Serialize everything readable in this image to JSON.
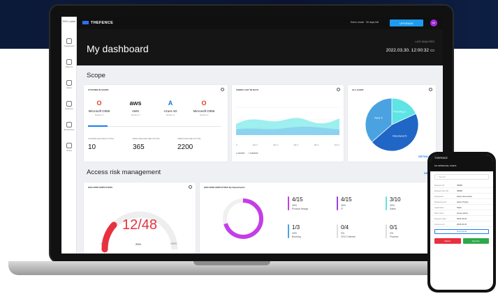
{
  "brand": "THEFENCE",
  "topbar": {
    "demo_mode": "Demo mode · 30 days left",
    "upgrade_label": "UPGRADE",
    "avatar_initials": "DP"
  },
  "sidebar": {
    "logo": "25% Label",
    "items": [
      {
        "label": "Dashboard",
        "icon": "home-icon"
      },
      {
        "label": "Reports",
        "icon": "document-icon"
      },
      {
        "label": "Alerts",
        "icon": "bell-icon"
      },
      {
        "label": "Systems",
        "icon": "layers-icon"
      },
      {
        "label": "Employees",
        "icon": "users-icon"
      },
      {
        "label": "Setup",
        "icon": "eye-icon"
      }
    ]
  },
  "header": {
    "title": "My dashboard",
    "last_analyzed_label": "LAST ANALYZED",
    "last_analyzed": "2022.03.30. 12:00:32"
  },
  "scope": {
    "title": "Scope",
    "systems_title": "SYSTEMS IN SCOPE",
    "systems": [
      {
        "logo": "O",
        "name": "Microsoft O365",
        "sub": "System 2",
        "color": "#e23b1e"
      },
      {
        "logo": "aws",
        "name": "AWS",
        "sub": "System 2",
        "color": "#222222"
      },
      {
        "logo": "A",
        "name": "Azure AD",
        "sub": "System 2",
        "color": "#1a73d9"
      },
      {
        "logo": "O",
        "name": "Microsoft O365",
        "sub": "System 2",
        "color": "#e23b1e"
      }
    ],
    "stats": [
      {
        "label": "SYSTEMS ANALYZED IN TOTAL",
        "value": "10"
      },
      {
        "label": "EMPLOYEE ANALYZED IN TOTAL",
        "value": "365"
      },
      {
        "label": "USERS ANALYZED IN TOTAL",
        "value": "2200"
      }
    ],
    "users_title": "USERS LAST 60 DAYS",
    "users_legend": [
      "Active",
      "Inactive"
    ],
    "users_x": [
      "0",
      "Jan 1",
      "Jan 1",
      "Jan 1",
      "Jan 1",
      "Jan 1"
    ],
    "alerts_title": "ALL ALERT",
    "alerts": [
      {
        "label": "Pending 2",
        "value": 2,
        "color": "#5ee4e4"
      },
      {
        "label": "Resolved 5",
        "value": 5,
        "color": "#1f66c7"
      },
      {
        "label": "New 4",
        "value": 4,
        "color": "#4aa3e0"
      }
    ],
    "details": "DETAILS"
  },
  "risk": {
    "title": "Access risk management",
    "details": "DETAILS",
    "high_risk_title": "HIGH RISK EMPLOYEES",
    "gauge_value": "12/48",
    "gauge_min": "0%",
    "gauge_mid": "25%",
    "gauge_max": "100%",
    "dept_title": "HIGH RISK EMPLOYEES By Departments",
    "departments": [
      {
        "fraction": "4/15",
        "percent": "26%",
        "name": "Product design",
        "color": "#c43ee6"
      },
      {
        "fraction": "4/15",
        "percent": "26%",
        "name": "IT",
        "color": "#9c3ee6"
      },
      {
        "fraction": "3/10",
        "percent": "30%",
        "name": "Sales",
        "color": "#5ee4e4"
      },
      {
        "fraction": "1/3",
        "percent": "33%",
        "name": "Booking",
        "color": "#4aa3e0"
      },
      {
        "fraction": "0/4",
        "percent": "0%",
        "name": "CEO Cabinet",
        "color": "#dddddd"
      },
      {
        "fraction": "0/1",
        "percent": "0%",
        "name": "Finance",
        "color": "#dddddd"
      }
    ]
  },
  "phone": {
    "brand": "THEFENCE",
    "title": "MY APPROVAL TASKS",
    "search_placeholder": "Search",
    "rows": [
      {
        "k": "Request ID",
        "v": "35698"
      },
      {
        "k": "Request item ID",
        "v": "35698"
      },
      {
        "k": "Requester",
        "v": "Helen Hernandez"
      },
      {
        "k": "Requested for",
        "v": "Helen Przyby"
      },
      {
        "k": "Application",
        "v": "Slack"
      },
      {
        "k": "Role name",
        "v": "Group admin"
      },
      {
        "k": "Request date",
        "v": "2023.03.30"
      },
      {
        "k": "Access end",
        "v": "2023.04.30"
      }
    ],
    "comments": "Comments",
    "reject": "Reject",
    "approve": "Approve"
  }
}
